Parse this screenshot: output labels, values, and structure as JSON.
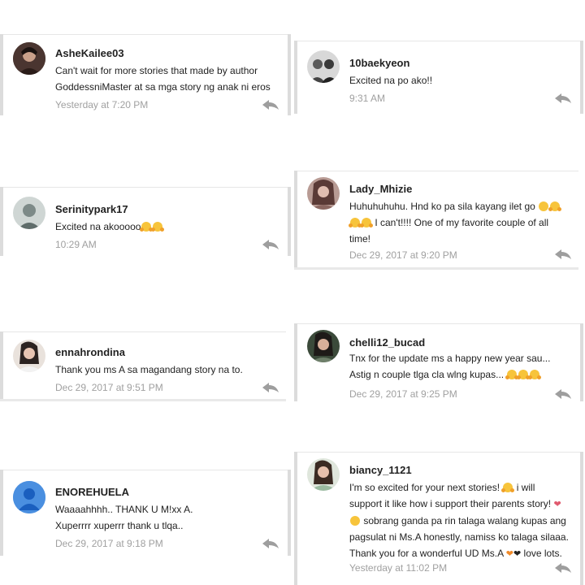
{
  "comments": [
    {
      "username": "AsheKailee03",
      "lines": [
        "Can't wait for more stories that made by author",
        "GoddessniMaster at sa mga story ng anak ni eros"
      ],
      "time": "Yesterday at 7:20 PM"
    },
    {
      "username": "10baekyeon",
      "lines": [
        "Excited na po ako!!"
      ],
      "time": "9:31 AM"
    },
    {
      "username": "Serinitypark17",
      "lines": [
        "Excited na akooooo"
      ],
      "time": "10:29 AM"
    },
    {
      "username": "Lady_Mhizie",
      "lines": [
        "Huhuhuhuhu.  Hnd ko pa sila kayang ilet go",
        "",
        " I can't!!!! One of my favorite couple of all",
        "time!"
      ],
      "time": "Dec 29, 2017 at 9:20 PM"
    },
    {
      "username": "ennahrondina",
      "lines": [
        "Thank you ms A sa magandang story na to."
      ],
      "time": "Dec 29, 2017 at 9:51 PM"
    },
    {
      "username": "chelli12_bucad",
      "lines": [
        "Tnx for the update ms a happy new year sau...",
        "Astig n couple tlga cla wlng kupas..."
      ],
      "time": "Dec 29, 2017 at 9:25 PM"
    },
    {
      "username": "ENOREHUELA",
      "lines": [
        "Waaaahhhh.. THANK U M!xx A.",
        "Xuperrrr xuperrr  thank u tlqa.."
      ],
      "time": "Dec 29, 2017 at 9:18 PM"
    },
    {
      "username": "biancy_1121",
      "lines": [
        "I'm so excited for your next stories!",
        " i will",
        "support it like how i support their parents story!",
        " sobrang ganda pa rin talaga walang kupas ang",
        "pagsulat ni Ms.A honestly, namiss ko talaga silaaa.",
        "Thank you for a wonderful UD Ms.A",
        " love lots."
      ],
      "time": "Yesterday at 11:02 PM"
    }
  ],
  "icons": {
    "reply": "reply-arrow-icon",
    "avatar": "user-avatar-icon",
    "emoji": "hugging-face-emoji-icon",
    "heart": "heart-icon"
  },
  "colors": {
    "username": "#222222",
    "timestamp": "#a0a0a0",
    "card_edge": "#dcdcdc",
    "default_avatar": "#4a8fe0"
  }
}
